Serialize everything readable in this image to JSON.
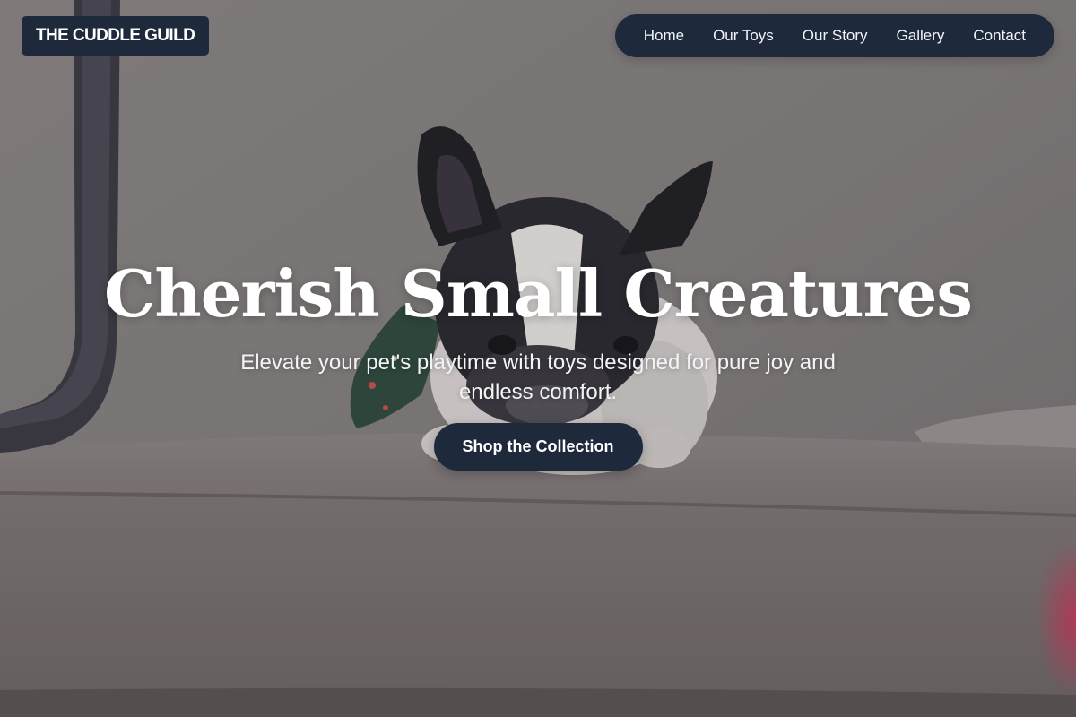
{
  "header": {
    "logo_text": "THE CUDDLE GUILD",
    "nav": [
      {
        "label": "Home"
      },
      {
        "label": "Our Toys"
      },
      {
        "label": "Our Story"
      },
      {
        "label": "Gallery"
      },
      {
        "label": "Contact"
      }
    ]
  },
  "hero": {
    "title": "Cherish Small Creatures",
    "subtitle": "Elevate your pet's playtime with toys designed for pure joy and endless comfort.",
    "cta_label": "Shop the Collection",
    "background_image": "french-bulldog-on-sofa-photo"
  },
  "colors": {
    "primary_dark": "#1e293b",
    "text_light": "#ffffff"
  }
}
